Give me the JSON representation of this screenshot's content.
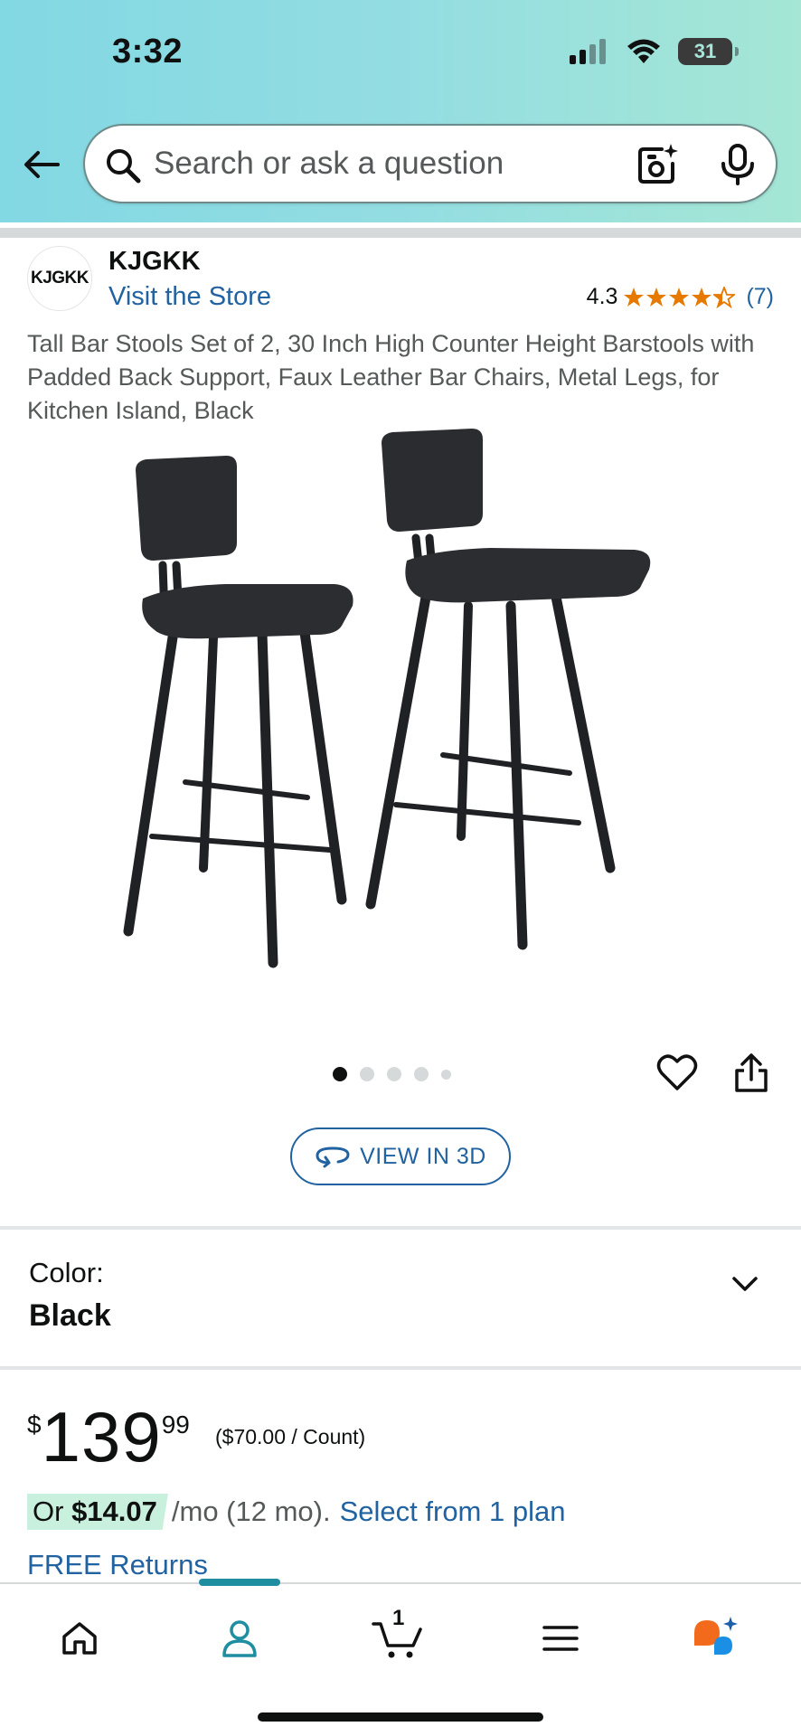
{
  "status_bar": {
    "time": "3:32",
    "battery": "31"
  },
  "search": {
    "placeholder": "Search or ask a question"
  },
  "brand": {
    "logo_text": "KJGKK",
    "name": "KJGKK",
    "store_link": "Visit the Store"
  },
  "rating": {
    "value": "4.3",
    "stars": 4.3,
    "count": "(7)"
  },
  "product": {
    "title": "Tall Bar Stools Set of 2, 30 Inch High Counter Height Barstools with Padded Back Support, Faux Leather Bar Chairs, Metal Legs, for Kitchen Island, Black",
    "image_count": 5,
    "active_image": 1,
    "view_3d_label": "VIEW IN 3D"
  },
  "color_selector": {
    "label": "Color:",
    "value": "Black"
  },
  "price": {
    "symbol": "$",
    "whole": "139",
    "fraction": "99",
    "unit_price": "($70.00 / Count)"
  },
  "installment": {
    "prefix": "Or ",
    "amount": "$14.07",
    "suffix": "/mo (12 mo).",
    "link": "Select from 1 plan"
  },
  "returns": {
    "label": "FREE Returns"
  },
  "bottom_nav": {
    "cart_count": "1",
    "items": [
      "home-icon",
      "account-icon",
      "cart-icon",
      "menu-icon",
      "rufus-assistant-icon"
    ],
    "active": "account-icon"
  },
  "colors": {
    "link": "#2162a1",
    "star": "#e67a00",
    "accent_teal": "#1e8ea0",
    "installment_highlight": "#c9f0dd"
  }
}
